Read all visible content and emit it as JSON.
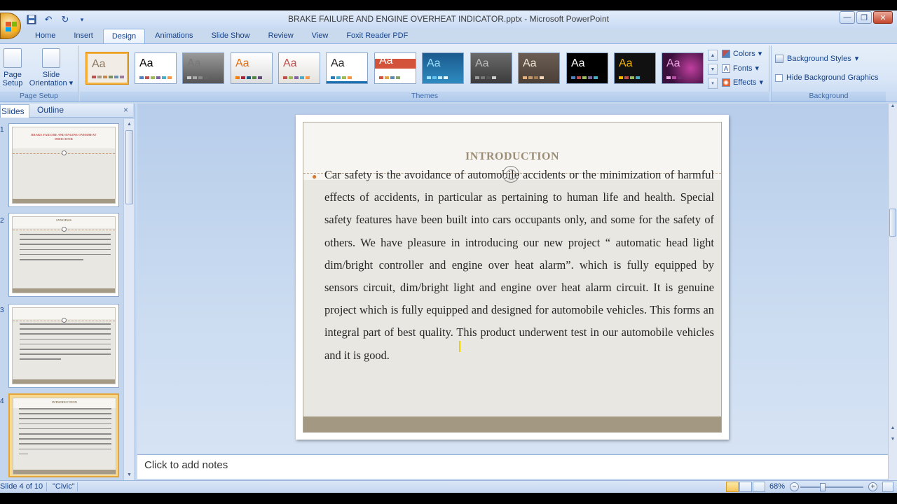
{
  "window": {
    "title": "BRAKE FAILURE AND ENGINE OVERHEAT INDICATOR.pptx - Microsoft PowerPoint"
  },
  "qat": {
    "save_icon": "save-icon",
    "undo_icon": "undo-icon",
    "redo_icon": "redo-icon",
    "customize_icon": "chevron-down-icon"
  },
  "tabs": [
    {
      "label": "Home"
    },
    {
      "label": "Insert"
    },
    {
      "label": "Design"
    },
    {
      "label": "Animations"
    },
    {
      "label": "Slide Show"
    },
    {
      "label": "Review"
    },
    {
      "label": "View"
    },
    {
      "label": "Foxit Reader PDF"
    }
  ],
  "active_tab": "Design",
  "ribbon": {
    "page_setup": {
      "group_label": "Page Setup",
      "page_setup_label_1": "Page",
      "page_setup_label_2": "Setup",
      "orientation_label_1": "Slide",
      "orientation_label_2": "Orientation"
    },
    "themes": {
      "group_label": "Themes",
      "sample": "Aa"
    },
    "theme_commands": {
      "colors": "Colors",
      "fonts": "Fonts",
      "effects": "Effects"
    },
    "background": {
      "group_label": "Background",
      "styles": "Background Styles",
      "hide_graphics": "Hide Background Graphics"
    }
  },
  "left_pane": {
    "tab_slides": "Slides",
    "tab_outline": "Outline",
    "close": "×",
    "thumbnails": [
      {
        "number": "1",
        "title": "BRAKE FAILURE AND ENGINE OVERHEAT INDICATOR"
      },
      {
        "number": "2",
        "title": "SYNOPSIS"
      },
      {
        "number": "3",
        "title": ""
      },
      {
        "number": "4",
        "title": "INTRODUCTION"
      }
    ]
  },
  "slide": {
    "title": "INTRODUCTION",
    "body": "Car safety is the avoidance of automobile accidents or the minimization of harmful effects of accidents, in particular as pertaining to human life and health. Special safety features have been built into cars occupants only, and some for the safety of others. We have pleasure in introducing our new project “ automatic head light dim/bright controller and engine over heat alarm”. which is fully equipped by sensors circuit, dim/bright light and engine over heat alarm circuit. It is genuine project which is fully equipped and designed for automobile vehicles. This forms an integral part of best quality. This product underwent test in our automobile vehicles and it is good."
  },
  "notes": {
    "placeholder": "Click to add notes"
  },
  "status_bar": {
    "slide_info": "Slide 4 of 10",
    "theme_name": "\"Civic\"",
    "zoom": "68%"
  },
  "colors": {
    "title_color": "#9c8d76",
    "accent_bullet": "#d07a3a",
    "footer_band": "#a39982"
  }
}
